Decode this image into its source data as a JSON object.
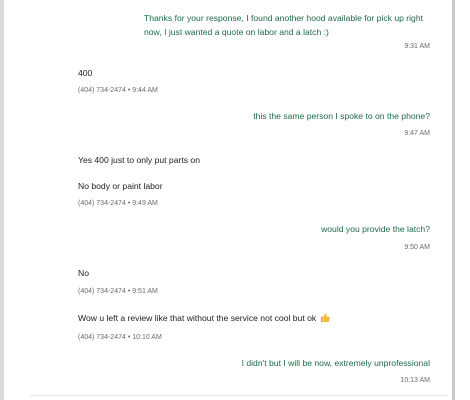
{
  "messages": [
    {
      "direction": "outgoing",
      "lines": [
        "Thanks for your response, I found another hood available for pick up right",
        "now, I just wanted a quote on labor and a latch :)"
      ],
      "meta": "9:31 AM"
    },
    {
      "direction": "incoming",
      "lines": [
        "400"
      ],
      "meta": "(404) 734-2474 • 9:44 AM"
    },
    {
      "direction": "outgoing",
      "lines": [
        "this the same person I spoke to on the phone?"
      ],
      "meta": "9:47 AM"
    },
    {
      "direction": "incoming",
      "lines": [
        "Yes 400 just to only put parts on"
      ]
    },
    {
      "direction": "incoming",
      "lines": [
        "No body or paint labor"
      ],
      "meta": "(404) 734-2474 • 9:49 AM"
    },
    {
      "direction": "outgoing",
      "lines": [
        "would you provide the latch?"
      ],
      "meta": "9:50 AM"
    },
    {
      "direction": "incoming",
      "lines": [
        "No"
      ],
      "meta": "(404) 734-2474 • 9:51 AM"
    },
    {
      "direction": "incoming",
      "lines": [
        "Wow u left a review like that without the service not cool but ok"
      ],
      "emoji": "thumbs-up-icon",
      "meta": "(404) 734-2474 • 10:10 AM"
    },
    {
      "direction": "outgoing",
      "lines": [
        "I didn't but I will be now, extremely unprofessional"
      ],
      "meta": "10:13 AM"
    }
  ]
}
